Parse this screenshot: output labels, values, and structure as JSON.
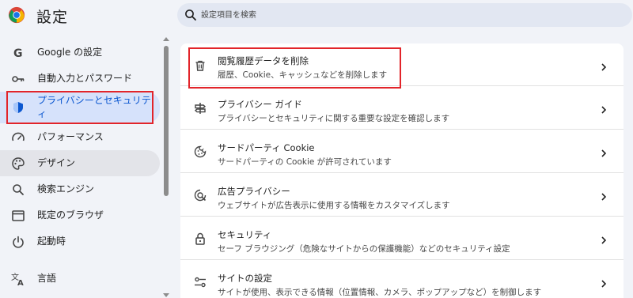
{
  "header": {
    "title": "設定",
    "search_placeholder": "設定項目を検索"
  },
  "sidebar": {
    "items": [
      {
        "label": "Google の設定",
        "icon": "google-icon"
      },
      {
        "label": "自動入力とパスワード",
        "icon": "key-icon"
      },
      {
        "label": "プライバシーとセキュリティ",
        "icon": "shield-icon",
        "active": true
      },
      {
        "label": "パフォーマンス",
        "icon": "speedometer-icon"
      },
      {
        "label": "デザイン",
        "icon": "palette-icon",
        "hover": true
      },
      {
        "label": "検索エンジン",
        "icon": "search-icon"
      },
      {
        "label": "既定のブラウザ",
        "icon": "browser-window-icon"
      },
      {
        "label": "起動時",
        "icon": "power-icon"
      },
      {
        "label": "言語",
        "icon": "translate-icon"
      }
    ]
  },
  "main": {
    "rows": [
      {
        "title": "閲覧履歴データを削除",
        "subtitle": "履歴、Cookie、キャッシュなどを削除します",
        "icon": "trash-icon"
      },
      {
        "title": "プライバシー ガイド",
        "subtitle": "プライバシーとセキュリティに関する重要な設定を確認します",
        "icon": "guide-icon"
      },
      {
        "title": "サードパーティ Cookie",
        "subtitle": "サードパーティの Cookie が許可されています",
        "icon": "cookie-icon"
      },
      {
        "title": "広告プライバシー",
        "subtitle": "ウェブサイトが広告表示に使用する情報をカスタマイズします",
        "icon": "ad-privacy-icon"
      },
      {
        "title": "セキュリティ",
        "subtitle": "セーフ ブラウジング（危険なサイトからの保護機能）などのセキュリティ設定",
        "icon": "lock-icon"
      },
      {
        "title": "サイトの設定",
        "subtitle": "サイトが使用、表示できる情報（位置情報、カメラ、ポップアップなど）を制御します",
        "icon": "sliders-icon"
      }
    ]
  },
  "colors": {
    "accent": "#0b57d0",
    "highlight_box": "#e2242a",
    "active_bg": "#d6e2fb"
  }
}
